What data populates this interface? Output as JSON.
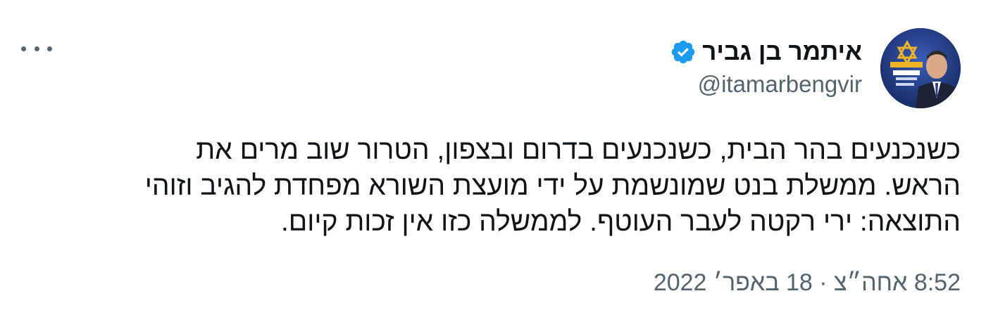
{
  "tweet": {
    "author": {
      "display_name": "איתמר בן גביר",
      "handle": "@itamarbengvir",
      "verified": true,
      "avatar_icon": "profile-photo"
    },
    "more_icon": "more-horizontal-icon",
    "text_lines": [
      "כשנכנעים בהר הבית, כשנכנעים בדרום ובצפון, הטרור שוב מרים את",
      "הראש. ממשלת בנט שמונשמת על ידי מועצת השורא מפחדת להגיב וזוהי",
      "התוצאה: ירי רקטה לעבר העוטף. לממשלה כזו אין זכות קיום."
    ],
    "timestamp": "8:52 אחה״צ · 18 באפר׳ 2022"
  },
  "colors": {
    "text": "#0f1419",
    "secondary": "#536471",
    "verified_blue": "#1d9bf0",
    "background": "#ffffff"
  }
}
